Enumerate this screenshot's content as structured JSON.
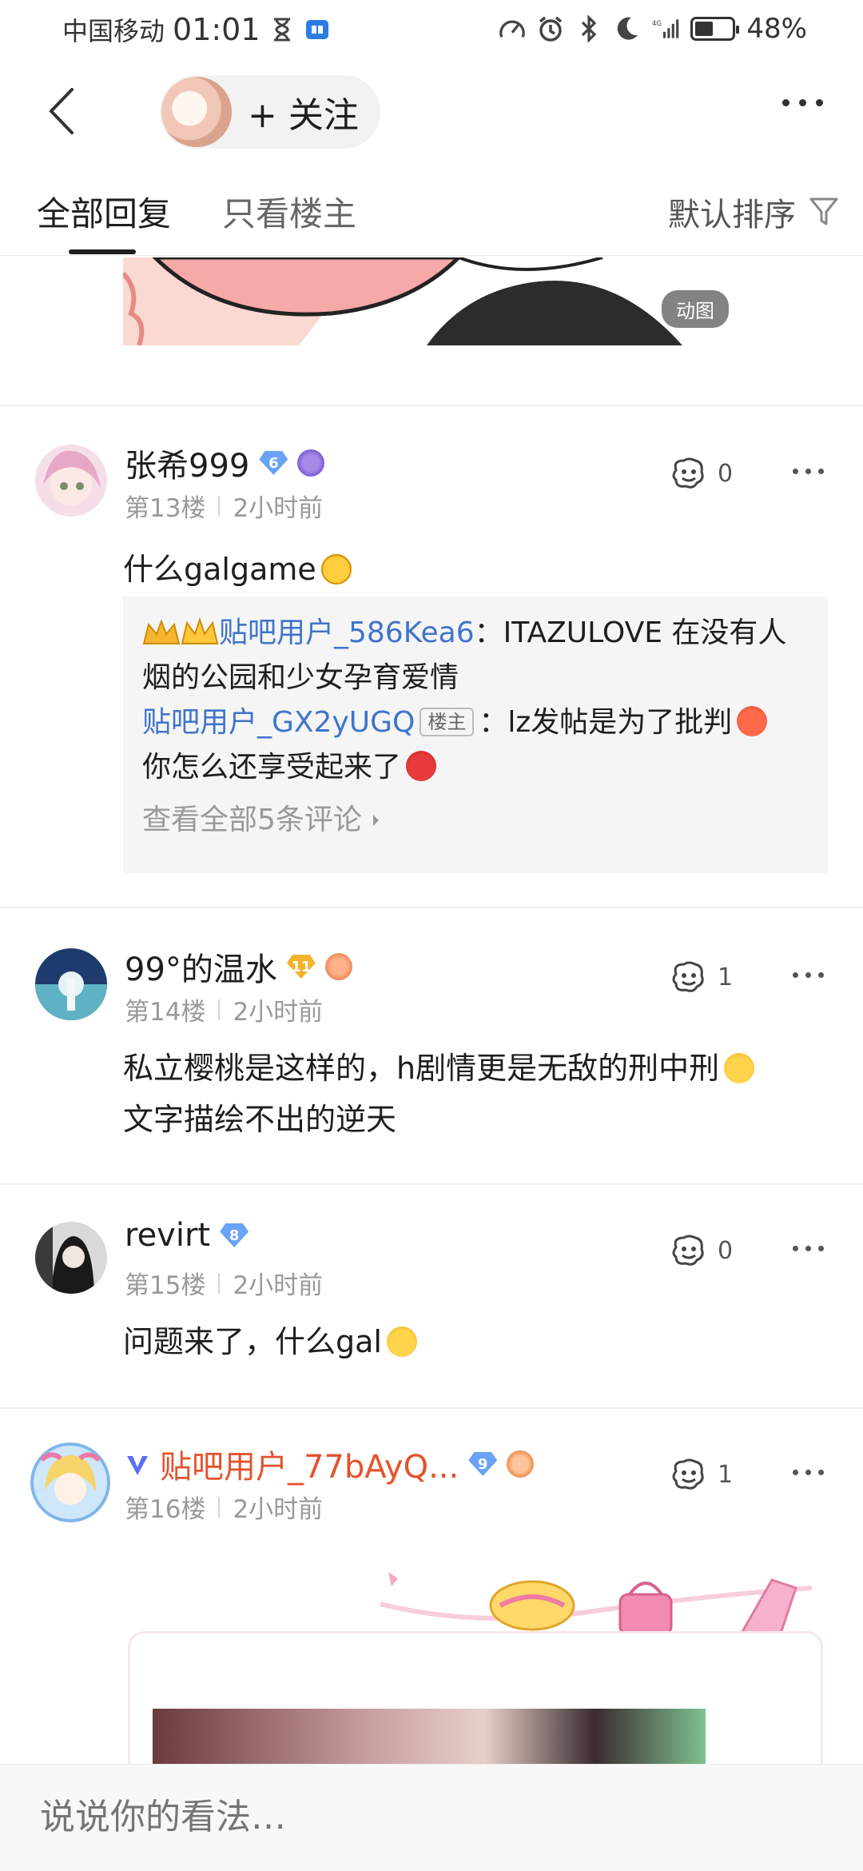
{
  "status_bar": {
    "carrier": "中国移动",
    "time": "01:01",
    "network": "4G",
    "battery": "48%",
    "battery_level": 0.48
  },
  "nav": {
    "follow_label": "+ 关注"
  },
  "tabs": {
    "all_replies": "全部回复",
    "only_op": "只看楼主",
    "sort_label": "默认排序"
  },
  "gif": {
    "badge": "动图"
  },
  "posts": [
    {
      "username": "张希999",
      "level": "6",
      "floor": "第13楼",
      "time": "2小时前",
      "likes": "0",
      "content": "什么galgame",
      "replies": [
        {
          "user": "贴吧用户_586Kea6",
          "sep": "：",
          "text": "ITAZULOVE 在没有人烟的公园和少女孕育爱情"
        },
        {
          "user": "贴吧用户_GX2yUGQ",
          "tag": "楼主",
          "sep": "：",
          "text": "lz发帖是为了批判",
          "text2": "你怎么还享受起来了"
        }
      ],
      "view_all": "查看全部5条评论"
    },
    {
      "username": "99°的温水",
      "level": "11",
      "floor": "第14楼",
      "time": "2小时前",
      "likes": "1",
      "content_line1": "私立樱桃是这样的，h剧情更是无敌的刑中刑",
      "content_line2": "文字描绘不出的逆天"
    },
    {
      "username": "revirt",
      "level": "8",
      "floor": "第15楼",
      "time": "2小时前",
      "likes": "0",
      "content": "问题来了，什么gal"
    },
    {
      "username": "贴吧用户_77bAyQ...",
      "level": "9",
      "floor": "第16楼",
      "time": "2小时前",
      "likes": "1"
    }
  ],
  "bottom": {
    "placeholder": "说说你的看法…"
  },
  "colors": {
    "vip_name": "#e4532d",
    "reply_user": "#3f74cc",
    "level_blue": "#6aa2f5",
    "level_gold": "#f3b42c"
  }
}
